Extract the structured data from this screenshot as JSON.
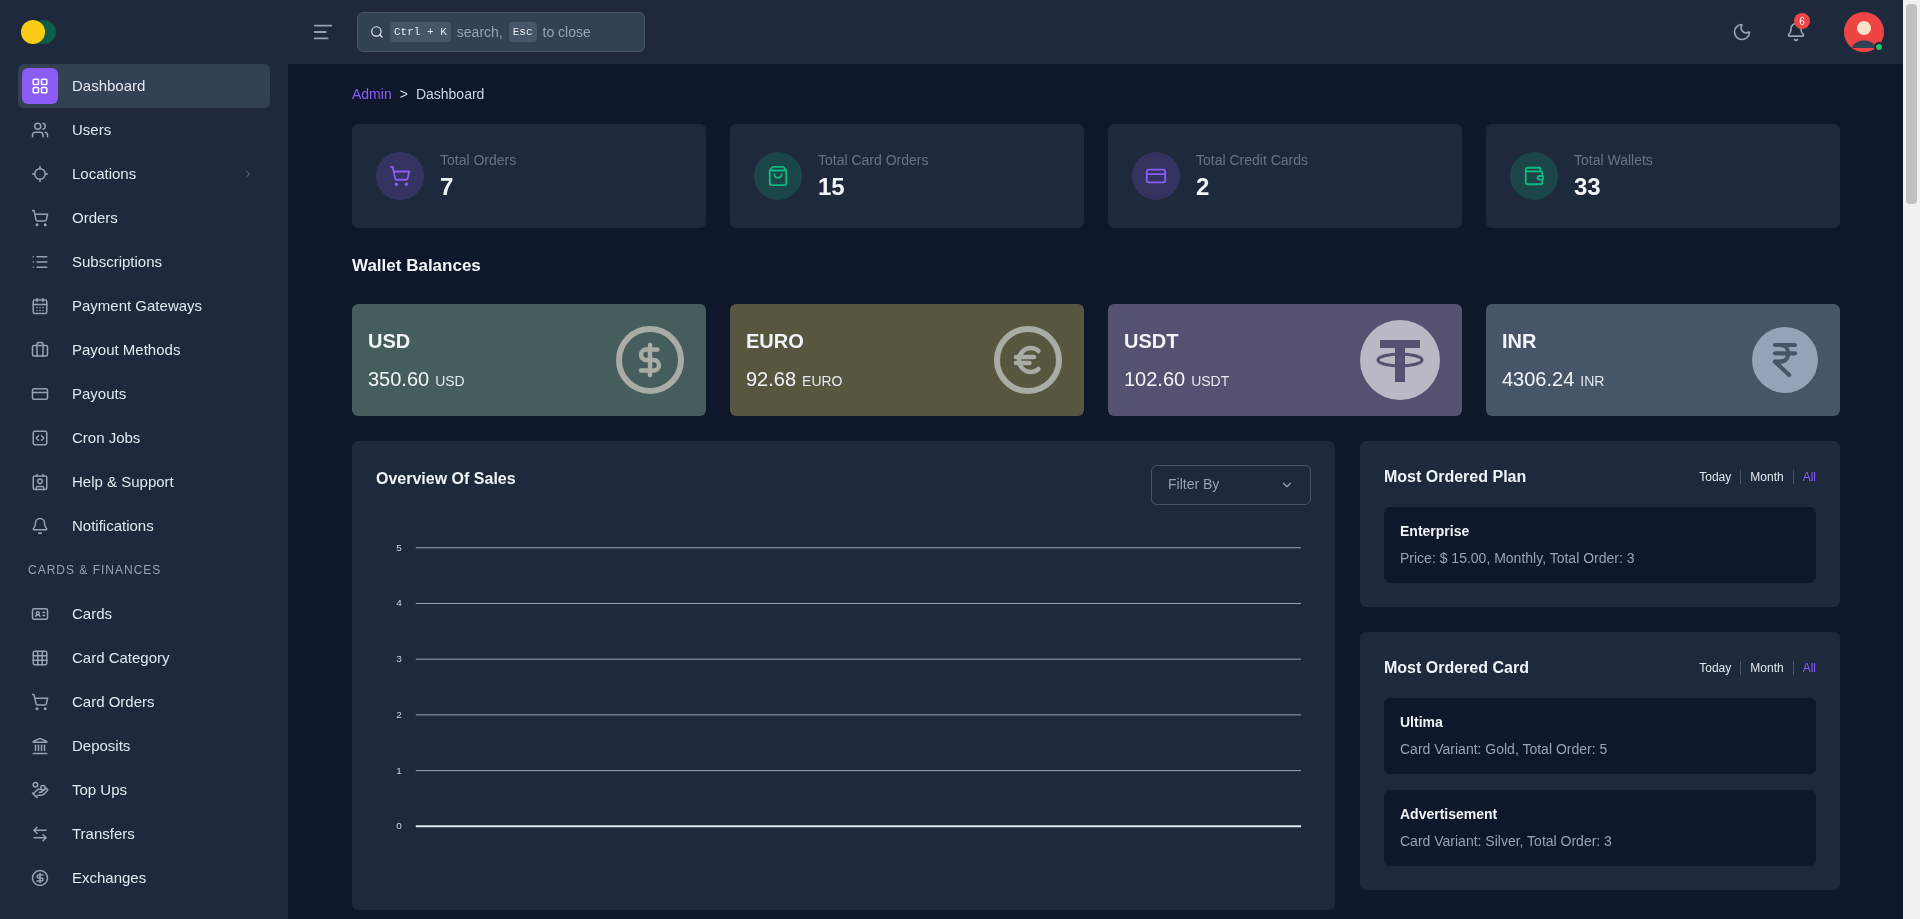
{
  "sidebar": {
    "items": [
      {
        "label": "Dashboard",
        "kind": "dashboard",
        "selected": true,
        "submenu": false
      },
      {
        "label": "Users",
        "kind": "users",
        "selected": false,
        "submenu": false
      },
      {
        "label": "Locations",
        "kind": "locate",
        "selected": false,
        "submenu": true
      },
      {
        "label": "Orders",
        "kind": "cart",
        "selected": false,
        "submenu": false
      },
      {
        "label": "Subscriptions",
        "kind": "list",
        "selected": false,
        "submenu": false
      },
      {
        "label": "Payment Gateways",
        "kind": "calendar",
        "selected": false,
        "submenu": false
      },
      {
        "label": "Payout Methods",
        "kind": "briefcase",
        "selected": false,
        "submenu": false
      },
      {
        "label": "Payouts",
        "kind": "card",
        "selected": false,
        "submenu": false
      },
      {
        "label": "Cron Jobs",
        "kind": "code",
        "selected": false,
        "submenu": false
      },
      {
        "label": "Help & Support",
        "kind": "support",
        "selected": false,
        "submenu": false
      },
      {
        "label": "Notifications",
        "kind": "bell",
        "selected": false,
        "submenu": false
      }
    ],
    "section_label": "CARDS & FINANCES",
    "section_items": [
      {
        "label": "Cards",
        "kind": "idcard",
        "selected": false,
        "submenu": false
      },
      {
        "label": "Card Category",
        "kind": "grid",
        "selected": false,
        "submenu": false
      },
      {
        "label": "Card Orders",
        "kind": "cart",
        "selected": false,
        "submenu": false
      },
      {
        "label": "Deposits",
        "kind": "bank",
        "selected": false,
        "submenu": false
      },
      {
        "label": "Top Ups",
        "kind": "handcoins",
        "selected": false,
        "submenu": false
      },
      {
        "label": "Transfers",
        "kind": "transfer",
        "selected": false,
        "submenu": false
      },
      {
        "label": "Exchanges",
        "kind": "exchange",
        "selected": false,
        "submenu": false
      }
    ]
  },
  "header": {
    "search": {
      "key_1": "Ctrl + K",
      "text_1": "search,",
      "key_2": "Esc",
      "text_2": "to close"
    },
    "notification_count": "6"
  },
  "breadcrumb": [
    "Admin",
    "Dashboard"
  ],
  "breadcrumb_separator": ">",
  "stats": [
    {
      "label": "Total Orders",
      "value": "7",
      "kind": "cart",
      "color": "#343360"
    },
    {
      "label": "Total Card Orders",
      "value": "15",
      "kind": "bag",
      "color": "#1b4649"
    },
    {
      "label": "Total Credit Cards",
      "value": "2",
      "kind": "card",
      "color": "#343360"
    },
    {
      "label": "Total Wallets",
      "value": "33",
      "kind": "wallet",
      "color": "#1b4649"
    }
  ],
  "wallet_title": "Wallet Balances",
  "wallets": [
    {
      "currency": "USD",
      "amount": "350.60",
      "unit": "USD",
      "kind": "dollar",
      "color": "#455d5c"
    },
    {
      "currency": "EURO",
      "amount": "92.68",
      "unit": "EURO",
      "kind": "euro",
      "color": "#57573f"
    },
    {
      "currency": "USDT",
      "amount": "102.60",
      "unit": "USDT",
      "kind": "tether",
      "color": "#545270"
    },
    {
      "currency": "INR",
      "amount": "4306.24",
      "unit": "INR",
      "kind": "rupee",
      "color": "#475569"
    }
  ],
  "sales": {
    "title": "Overview Of Sales",
    "filter": {
      "placeholder": "Filter By"
    },
    "chart_data": {
      "type": "line",
      "categories": [
        null,
        null,
        null,
        null,
        null,
        null,
        null,
        null,
        null,
        null,
        null,
        null
      ],
      "series": [
        {
          "color": "#e2e8f0",
          "values": [
            0,
            0,
            0,
            0,
            0,
            0,
            0,
            0,
            0,
            0,
            0,
            0
          ]
        }
      ],
      "grid": true,
      "ylim": [
        0,
        5
      ],
      "yticks": [
        0,
        1,
        2,
        3,
        4,
        5
      ]
    }
  },
  "panels": [
    {
      "title": "Most Ordered Plan",
      "tabs": [
        {
          "label": "Today",
          "selected": false
        },
        {
          "label": "Month",
          "selected": false
        },
        {
          "label": "All",
          "selected": true
        }
      ],
      "items": [
        {
          "name": "Enterprise",
          "detail": "Price: $ 15.00, Monthly, Total Order: 3"
        }
      ]
    },
    {
      "title": "Most Ordered Card",
      "tabs": [
        {
          "label": "Today",
          "selected": false
        },
        {
          "label": "Month",
          "selected": false
        },
        {
          "label": "All",
          "selected": true
        }
      ],
      "items": [
        {
          "name": "Ultima",
          "detail": "Card Variant: Gold, Total Order: 5"
        },
        {
          "name": "Advertisement",
          "detail": "Card Variant: Silver, Total Order: 3"
        }
      ]
    }
  ]
}
